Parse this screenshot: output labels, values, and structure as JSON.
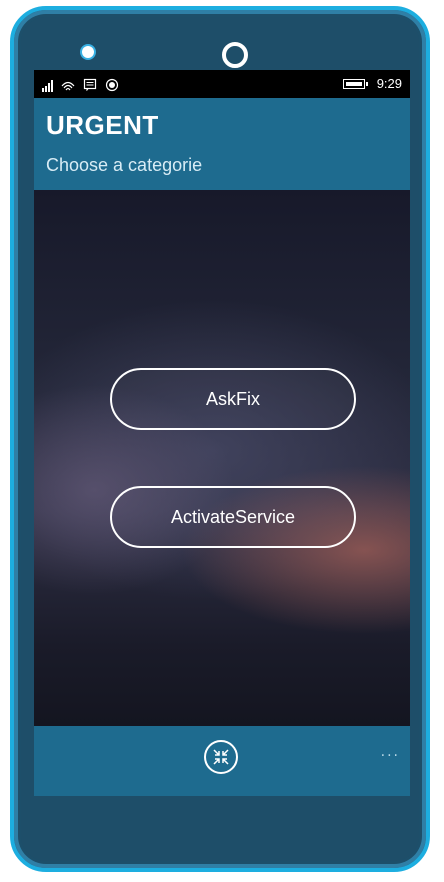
{
  "status_bar": {
    "time": "9:29",
    "icons": [
      "signal-icon",
      "wifi-icon",
      "message-icon",
      "record-icon",
      "battery-icon"
    ]
  },
  "header": {
    "title": "URGENT",
    "subtitle": "Choose a categorie"
  },
  "main": {
    "buttons": [
      {
        "label": "AskFix"
      },
      {
        "label": "ActivateService"
      }
    ]
  },
  "app_bar": {
    "center_icon": "compress-arrows-icon",
    "more_label": "..."
  },
  "colors": {
    "accent": "#1e6b8f",
    "phone_border": "#1daee0",
    "phone_body": "#1e4e69"
  }
}
